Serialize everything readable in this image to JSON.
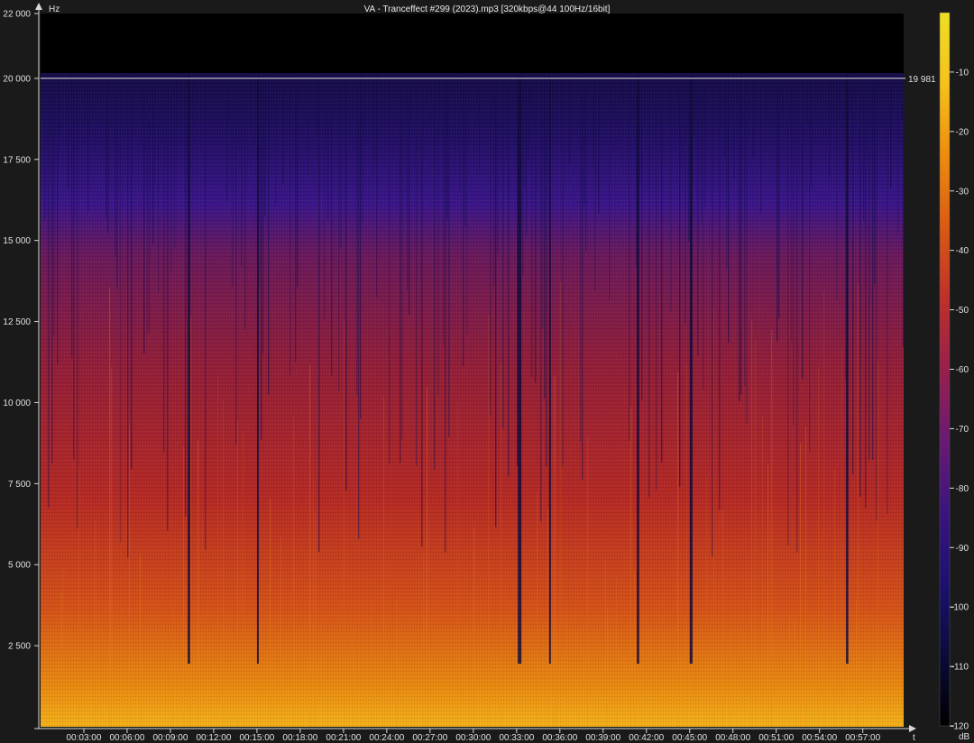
{
  "chart_data": {
    "type": "heatmap",
    "title": "VA - Tranceffect #299 (2023).mp3 [320kbps@44 100Hz/16bit]",
    "xlabel": "t",
    "ylabel": "Hz",
    "colorbar_label": "dB",
    "x_axis": {
      "range_seconds": [
        0,
        3590
      ],
      "tick_labels": [
        "00:03:00",
        "00:06:00",
        "00:09:00",
        "00:12:00",
        "00:15:00",
        "00:18:00",
        "00:21:00",
        "00:24:00",
        "00:27:00",
        "00:30:00",
        "00:33:00",
        "00:36:00",
        "00:39:00",
        "00:42:00",
        "00:45:00",
        "00:48:00",
        "00:51:00",
        "00:54:00",
        "00:57:00"
      ],
      "tick_values_seconds": [
        180,
        360,
        540,
        720,
        900,
        1080,
        1260,
        1440,
        1620,
        1800,
        1980,
        2160,
        2340,
        2520,
        2700,
        2880,
        3060,
        3240,
        3420
      ]
    },
    "y_axis": {
      "range": [
        0,
        22000
      ],
      "tick_labels": [
        "22 000",
        "20 000",
        "17 500",
        "15 000",
        "12 500",
        "10 000",
        "7 500",
        "5 000",
        "2 500"
      ],
      "tick_values": [
        22000,
        20000,
        17500,
        15000,
        12500,
        10000,
        7500,
        5000,
        2500
      ]
    },
    "colorbar": {
      "range": [
        -120,
        0
      ],
      "tick_labels": [
        "-10",
        "-20",
        "-30",
        "-40",
        "-50",
        "-60",
        "-70",
        "-80",
        "-90",
        "-100",
        "-110",
        "-120"
      ],
      "tick_values": [
        -10,
        -20,
        -30,
        -40,
        -50,
        -60,
        -70,
        -80,
        -90,
        -100,
        -110,
        -120
      ],
      "colors": [
        "#000000",
        "#0b0b3a",
        "#1c1170",
        "#3a147e",
        "#6a1a74",
        "#9a1f4a",
        "#c0302a",
        "#dc5a12",
        "#ee8c0c",
        "#f6c21a",
        "#eede24"
      ]
    },
    "cutoff_line": {
      "value": 20000,
      "label": "19 981",
      "color": "#e8e8e8"
    },
    "quiet_segments_seconds": [
      [
        1985,
        2000
      ],
      [
        2700,
        2712
      ],
      [
        3350,
        3360
      ],
      [
        612,
        622
      ],
      [
        900,
        906
      ],
      [
        2115,
        2122
      ],
      [
        2480,
        2490
      ]
    ]
  }
}
